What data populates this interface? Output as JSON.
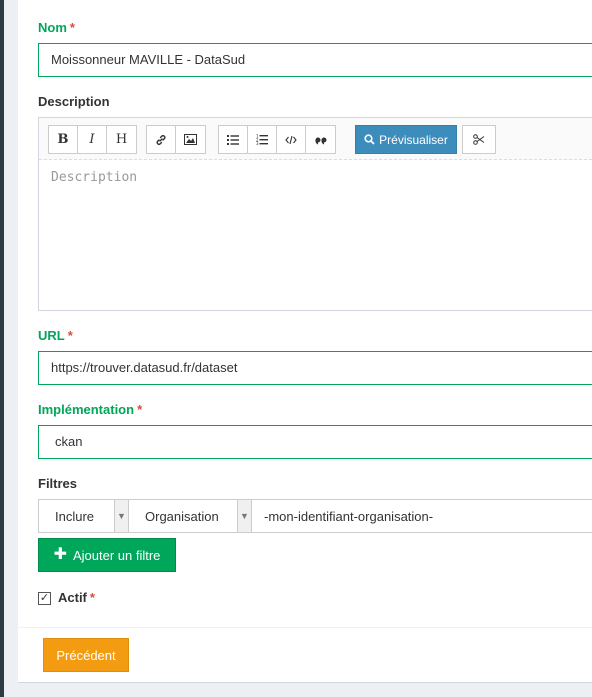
{
  "form": {
    "nom": {
      "label": "Nom",
      "required": "*",
      "value": "Moissonneur MAVILLE - DataSud"
    },
    "description": {
      "label": "Description",
      "placeholder": "Description",
      "toolbar": {
        "bold": "B",
        "italic": "I",
        "heading": "H",
        "link_icon": "link-icon",
        "image_icon": "image-icon",
        "ul_icon": "unordered-list-icon",
        "ol_icon": "ordered-list-icon",
        "code_icon": "code-icon",
        "quote_icon": "quote-icon",
        "preview_label": "Prévisualiser",
        "preview_icon": "search-icon",
        "fullscreen_icon": "scissors-icon"
      }
    },
    "url": {
      "label": "URL",
      "required": "*",
      "value": "https://trouver.datasud.fr/dataset"
    },
    "implementation": {
      "label": "Implémentation",
      "required": "*",
      "value": "ckan"
    },
    "filtres": {
      "label": "Filtres",
      "type_value": "Inclure",
      "field_value": "Organisation",
      "filter_value": "-mon-identifiant-organisation-",
      "add_label": "Ajouter un filtre"
    },
    "actif": {
      "label": "Actif",
      "required": "*",
      "checked": true
    }
  },
  "footer": {
    "prev_label": "Précédent"
  },
  "colors": {
    "required": "#dd4b39",
    "success": "#00a65a",
    "primary": "#3c8dbc",
    "warning": "#f39c12"
  }
}
